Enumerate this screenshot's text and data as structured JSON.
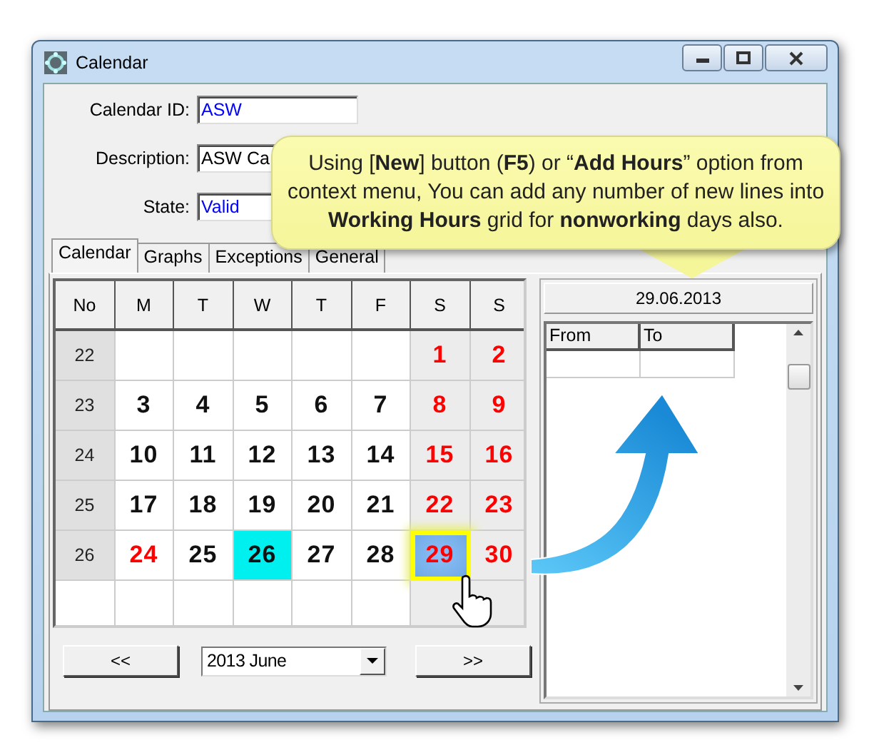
{
  "window": {
    "title": "Calendar"
  },
  "fields": [
    {
      "label": "Calendar ID:",
      "value": "ASW",
      "color": "#0000ff"
    },
    {
      "label": "Description:",
      "value": "ASW Ca",
      "color": "#000000"
    },
    {
      "label": "State:",
      "value": "Valid",
      "color": "#0000ff"
    }
  ],
  "tabs": [
    {
      "label": "Calendar",
      "selected": true
    },
    {
      "label": "Graphs",
      "selected": false
    },
    {
      "label": "Exceptions",
      "selected": false
    },
    {
      "label": "General",
      "selected": false
    }
  ],
  "calendar": {
    "columns": [
      {
        "label": "No"
      },
      {
        "label": "M",
        "weekend": false
      },
      {
        "label": "T",
        "weekend": false
      },
      {
        "label": "W",
        "weekend": false
      },
      {
        "label": "T",
        "weekend": false
      },
      {
        "label": "F",
        "weekend": false
      },
      {
        "label": "S",
        "weekend": true
      },
      {
        "label": "S",
        "weekend": true
      }
    ],
    "weeks": [
      {
        "number": "22",
        "days": [
          {
            "kind": "blank"
          },
          {
            "kind": "blank"
          },
          {
            "kind": "blank"
          },
          {
            "kind": "blank"
          },
          {
            "kind": "blank"
          },
          {
            "kind": "day",
            "text": "1",
            "nonworking": true,
            "today": false,
            "selected": false
          },
          {
            "kind": "day",
            "text": "2",
            "nonworking": true,
            "today": false,
            "selected": false
          }
        ]
      },
      {
        "number": "23",
        "days": [
          {
            "kind": "day",
            "text": "3",
            "nonworking": false,
            "today": false,
            "selected": false
          },
          {
            "kind": "day",
            "text": "4",
            "nonworking": false,
            "today": false,
            "selected": false
          },
          {
            "kind": "day",
            "text": "5",
            "nonworking": false,
            "today": false,
            "selected": false
          },
          {
            "kind": "day",
            "text": "6",
            "nonworking": false,
            "today": false,
            "selected": false
          },
          {
            "kind": "day",
            "text": "7",
            "nonworking": false,
            "today": false,
            "selected": false
          },
          {
            "kind": "day",
            "text": "8",
            "nonworking": true,
            "today": false,
            "selected": false
          },
          {
            "kind": "day",
            "text": "9",
            "nonworking": true,
            "today": false,
            "selected": false
          }
        ]
      },
      {
        "number": "24",
        "days": [
          {
            "kind": "day",
            "text": "10",
            "nonworking": false,
            "today": false,
            "selected": false
          },
          {
            "kind": "day",
            "text": "11",
            "nonworking": false,
            "today": false,
            "selected": false
          },
          {
            "kind": "day",
            "text": "12",
            "nonworking": false,
            "today": false,
            "selected": false
          },
          {
            "kind": "day",
            "text": "13",
            "nonworking": false,
            "today": false,
            "selected": false
          },
          {
            "kind": "day",
            "text": "14",
            "nonworking": false,
            "today": false,
            "selected": false
          },
          {
            "kind": "day",
            "text": "15",
            "nonworking": true,
            "today": false,
            "selected": false
          },
          {
            "kind": "day",
            "text": "16",
            "nonworking": true,
            "today": false,
            "selected": false
          }
        ]
      },
      {
        "number": "25",
        "days": [
          {
            "kind": "day",
            "text": "17",
            "nonworking": false,
            "today": false,
            "selected": false
          },
          {
            "kind": "day",
            "text": "18",
            "nonworking": false,
            "today": false,
            "selected": false
          },
          {
            "kind": "day",
            "text": "19",
            "nonworking": false,
            "today": false,
            "selected": false
          },
          {
            "kind": "day",
            "text": "20",
            "nonworking": false,
            "today": false,
            "selected": false
          },
          {
            "kind": "day",
            "text": "21",
            "nonworking": false,
            "today": false,
            "selected": false
          },
          {
            "kind": "day",
            "text": "22",
            "nonworking": true,
            "today": false,
            "selected": false
          },
          {
            "kind": "day",
            "text": "23",
            "nonworking": true,
            "today": false,
            "selected": false
          }
        ]
      },
      {
        "number": "26",
        "days": [
          {
            "kind": "day",
            "text": "24",
            "nonworking": true,
            "today": false,
            "selected": false
          },
          {
            "kind": "day",
            "text": "25",
            "nonworking": false,
            "today": false,
            "selected": false
          },
          {
            "kind": "day",
            "text": "26",
            "nonworking": false,
            "today": true,
            "selected": false
          },
          {
            "kind": "day",
            "text": "27",
            "nonworking": false,
            "today": false,
            "selected": false
          },
          {
            "kind": "day",
            "text": "28",
            "nonworking": false,
            "today": false,
            "selected": false
          },
          {
            "kind": "day",
            "text": "29",
            "nonworking": true,
            "today": false,
            "selected": true
          },
          {
            "kind": "day",
            "text": "30",
            "nonworking": true,
            "today": false,
            "selected": false
          }
        ]
      },
      {
        "days": [
          {
            "kind": "blank"
          },
          {
            "kind": "blank"
          },
          {
            "kind": "blank"
          },
          {
            "kind": "blank"
          },
          {
            "kind": "blank"
          },
          {
            "kind": "blank"
          },
          {
            "kind": "blank"
          }
        ]
      }
    ]
  },
  "navigation": {
    "previous": "<<",
    "month": "2013 June",
    "next": ">>"
  },
  "detail": {
    "date": "29.06.2013",
    "columns": [
      "From",
      "To"
    ]
  },
  "callout": {
    "text": "Using [**New**] button (**F5**) or “**Add Hours**” option from context menu, You can add any number of new lines into **Working Hours** grid for **nonworking** days also."
  }
}
